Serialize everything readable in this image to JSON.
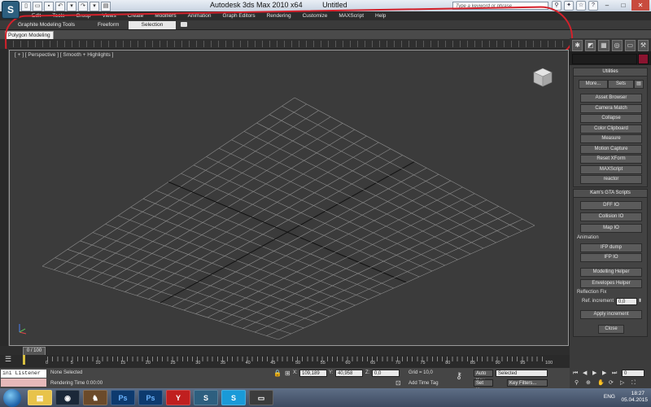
{
  "titlebar": {
    "app_name": "Autodesk 3ds Max  2010 x64",
    "doc_title": "Untitled",
    "search_placeholder": "Type a keyword or phrase",
    "app_logo_glyph": "S"
  },
  "menu": [
    "Edit",
    "Tools",
    "Group",
    "Views",
    "Create",
    "Modifiers",
    "Animation",
    "Graph Editors",
    "Rendering",
    "Customize",
    "MAXScript",
    "Help"
  ],
  "ribbon": {
    "tabs": [
      "Graphite Modeling Tools",
      "Freeform",
      "Selection"
    ],
    "active_tab": "Selection",
    "subtab": "Polygon Modeling"
  },
  "viewport": {
    "label": "[ + ] [ Perspective ] [ Smooth + Highlights ]"
  },
  "utilities": {
    "header": "Utilities",
    "more_label": "More...",
    "sets_label": "Sets",
    "buttons": [
      "Asset Browser",
      "Camera Match",
      "Collapse",
      "Color Clipboard",
      "Measure",
      "Motion Capture",
      "Reset XForm",
      "MAXScript",
      "reactor"
    ]
  },
  "gta_scripts": {
    "header": "Kam's GTA Scripts",
    "io_buttons": [
      "DFF IO",
      "Collision IO",
      "Map IO"
    ],
    "animation_label": "Animation",
    "anim_buttons": [
      "IFP dump",
      "IFP IO"
    ],
    "helper_buttons": [
      "Modelling Helper",
      "Envelopes Helper"
    ],
    "reflection_label": "Reflection Fix",
    "ref_increment_label": "Ref. increment",
    "ref_increment_value": "0,0",
    "apply_label": "Apply increment",
    "close_label": "Close"
  },
  "timeline": {
    "slider_label": "0 / 100",
    "ticks": [
      "0",
      "5",
      "10",
      "15",
      "20",
      "25",
      "30",
      "35",
      "40",
      "45",
      "50",
      "55",
      "60",
      "65",
      "70",
      "75",
      "80",
      "85",
      "90",
      "95",
      "100"
    ]
  },
  "status": {
    "listener": "ini Listener",
    "selection": "None Selected",
    "rendering_time": "Rendering Time  0:00:00",
    "x_label": "X:",
    "x_value": "109,189",
    "y_label": "Y:",
    "y_value": "40,958",
    "z_label": "Z:",
    "z_value": "0,0",
    "grid": "Grid = 10,0",
    "add_time_tag": "Add Time Tag",
    "auto_key": "Auto Key",
    "selected": "Selected",
    "set_key": "Set Key",
    "key_filters": "Key Filters...",
    "frame_value": "0"
  },
  "taskbar": {
    "lang": "ENG",
    "time": "18:27",
    "date": "05.04.2015",
    "apps": [
      "Explorer",
      "Steam",
      "Game",
      "Ps",
      "Ps",
      "Yandex",
      "3ds Max",
      "Skype",
      "Window"
    ]
  },
  "colors": {
    "annotation": "#d4212b",
    "object_color": "#8a1430"
  }
}
